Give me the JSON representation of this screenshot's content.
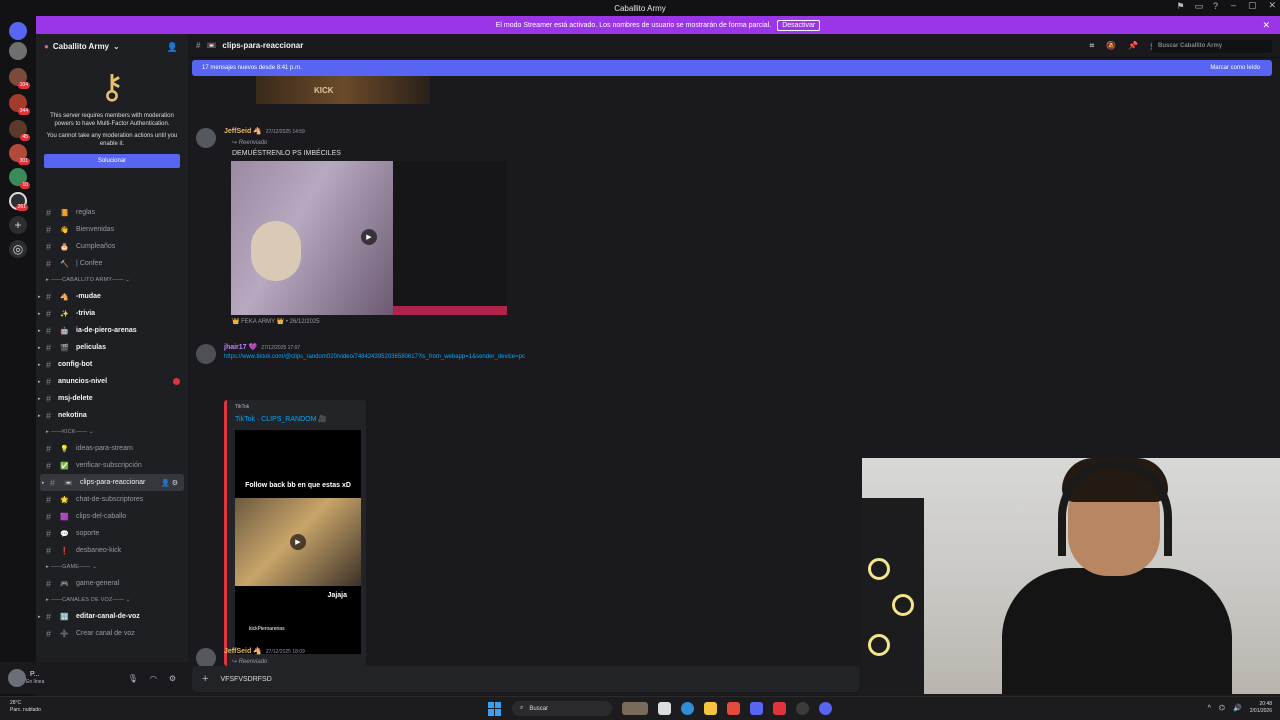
{
  "window": {
    "title": "Caballito Army"
  },
  "streamer_bar": {
    "message": "El modo Streamer está activado. Los nombres de usuario se mostrarán de forma parcial.",
    "button": "Desactivar"
  },
  "guilds": [
    {
      "badge": ""
    },
    {
      "badge": "104"
    },
    {
      "badge": "344"
    },
    {
      "badge": "45"
    },
    {
      "badge": "301"
    },
    {
      "badge": "10"
    },
    {
      "badge": "261"
    }
  ],
  "sidebar": {
    "server_name": "Caballito Army",
    "mfa": {
      "line1": "This server requires members with moderation powers to have Multi-Factor Authentication.",
      "line2": "You cannot take any moderation actions until you enable it.",
      "button": "Solucionar"
    },
    "channels": [
      {
        "kind": "chan",
        "emoji": "📙",
        "name": "reglas",
        "bold": false
      },
      {
        "kind": "chan",
        "emoji": "👋",
        "name": "Bienvenidas",
        "bold": false
      },
      {
        "kind": "chan",
        "emoji": "🎂",
        "name": "Cumpleaños",
        "bold": false
      },
      {
        "kind": "chan",
        "emoji": "🔨",
        "name": "| Confee",
        "bold": false
      },
      {
        "kind": "cat",
        "name": "CABALLITO ARMY"
      },
      {
        "kind": "chan",
        "emoji": "🐴",
        "name": "-mudae",
        "bold": true
      },
      {
        "kind": "chan",
        "emoji": "✨",
        "name": "-trivia",
        "bold": true
      },
      {
        "kind": "chan",
        "emoji": "🤖",
        "name": "ia-de-piero-arenas",
        "bold": true
      },
      {
        "kind": "chan",
        "emoji": "🎬",
        "name": "peliculas",
        "bold": true
      },
      {
        "kind": "chan",
        "emoji": "",
        "name": "config-bot",
        "bold": true
      },
      {
        "kind": "chan",
        "emoji": "",
        "name": "anuncios-nivel",
        "bold": true,
        "dot": true
      },
      {
        "kind": "chan",
        "emoji": "",
        "name": "msj-delete",
        "bold": true
      },
      {
        "kind": "chan",
        "emoji": "",
        "name": "nekotina",
        "bold": true
      },
      {
        "kind": "cat",
        "name": "KICK"
      },
      {
        "kind": "chan",
        "emoji": "💡",
        "name": "ideas-para-stream",
        "bold": false
      },
      {
        "kind": "chan",
        "emoji": "✅",
        "name": "verificar-subscripción",
        "bold": false
      },
      {
        "kind": "chan",
        "emoji": "📼",
        "name": "clips-para-reaccionar",
        "bold": false,
        "active": true
      },
      {
        "kind": "chan",
        "emoji": "🌟",
        "name": "chat-de-subscriptores",
        "bold": false
      },
      {
        "kind": "chan",
        "emoji": "🟪",
        "name": "clips-del-caballo",
        "bold": false
      },
      {
        "kind": "chan",
        "emoji": "💬",
        "name": "soporte",
        "bold": false
      },
      {
        "kind": "chan",
        "emoji": "❗",
        "name": "desbaneo-kick",
        "bold": false
      },
      {
        "kind": "cat",
        "name": "GAME"
      },
      {
        "kind": "chan",
        "emoji": "🎮",
        "name": "game-general",
        "bold": false
      },
      {
        "kind": "cat",
        "name": "CANALES DE VOZ"
      },
      {
        "kind": "chan",
        "emoji": "🔢",
        "name": "editar-canal-de-voz",
        "bold": true
      },
      {
        "kind": "chan",
        "emoji": "➕",
        "name": "Crear canal de voz",
        "bold": false
      }
    ]
  },
  "user": {
    "name": "P...",
    "status": "En línea"
  },
  "channel": {
    "name": "clips-para-reaccionar",
    "search_placeholder": "Buscar Caballito Army"
  },
  "new_messages": {
    "text": "17 mensajes nuevos desde 8:41 p.m.",
    "action": "Marcar como leído"
  },
  "messages": [
    {
      "author": "JeffSeid 🐴",
      "time": "27/12/2025 14:59",
      "forwarded": "Reenviado",
      "text": "DEMUÉSTRENLO PS IMBÉCILES",
      "source": "👑 FEKA ARMY 👑 • 26/12/2025"
    },
    {
      "author": "jhair17 💜",
      "time": "27/12/2025 17:07",
      "link": "https://www.tiktok.com/@clips_random020/video/7484243952036580617?is_from_webapp=1&sender_device=pc",
      "embed": {
        "provider": "TikTok",
        "title": "TikTok · CLIPS_RANDOM 🎥",
        "caption_top": "Follow back bb en que estas xD",
        "caption_mid": "Jajaja",
        "caption_bottom": "kickPieroarenas"
      }
    },
    {
      "author": "JeffSeid 🐴",
      "time": "27/12/2025 18:09",
      "forwarded": "Reenviado"
    }
  ],
  "top_clip": {
    "label": "KICK"
  },
  "composer": {
    "value": "VFSFVSDRFSD"
  },
  "taskbar": {
    "weather": "28°C",
    "weather_desc": "Parc. nublado",
    "search": "Buscar",
    "time": "20:48",
    "date": "2/01/2026"
  }
}
